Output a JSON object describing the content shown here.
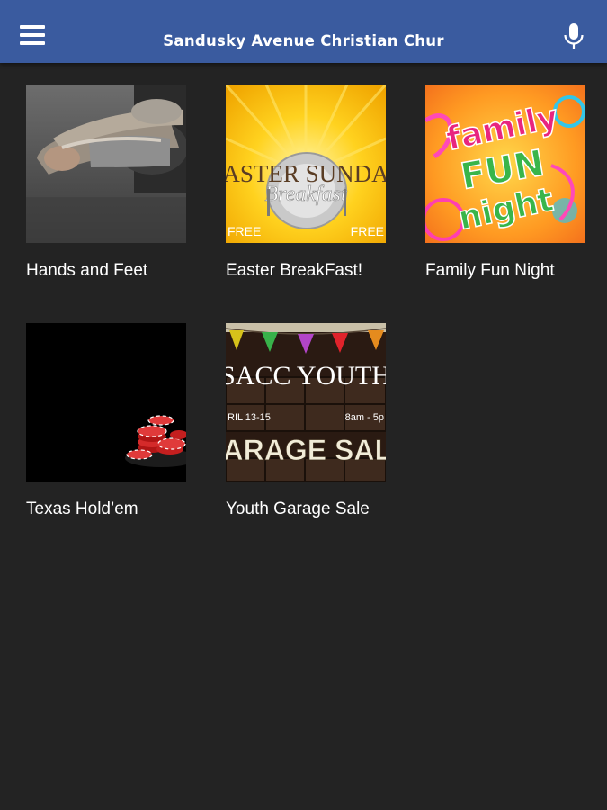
{
  "header": {
    "title": "Sandusky Avenue Christian Chur",
    "background": "#3a5b9f",
    "menu_icon": "hamburger-menu-icon",
    "mic_icon": "microphone-icon"
  },
  "tiles": [
    {
      "label": "Hands and Feet",
      "image": "dirty-feet-photo"
    },
    {
      "label": "Easter BreakFast!",
      "image": "easter-sunday-breakfast-graphic",
      "image_text": {
        "line1": "ASTER SUNDA",
        "line2": "Breakfast",
        "free_left": "FREE",
        "free_right": "FREE"
      }
    },
    {
      "label": "Family Fun Night",
      "image": "family-fun-night-graphic",
      "image_text": {
        "line1": "family",
        "line2": "FUN",
        "line3": "night"
      }
    },
    {
      "label": "Texas Hold’em",
      "image": "poker-chips-photo"
    },
    {
      "label": "Youth Garage Sale",
      "image": "youth-garage-sale-graphic",
      "image_text": {
        "line1": "SACC YOUTH",
        "date": "RIL 13-15",
        "time": "8am - 5p",
        "line2": "GARAGE SALE"
      }
    }
  ]
}
